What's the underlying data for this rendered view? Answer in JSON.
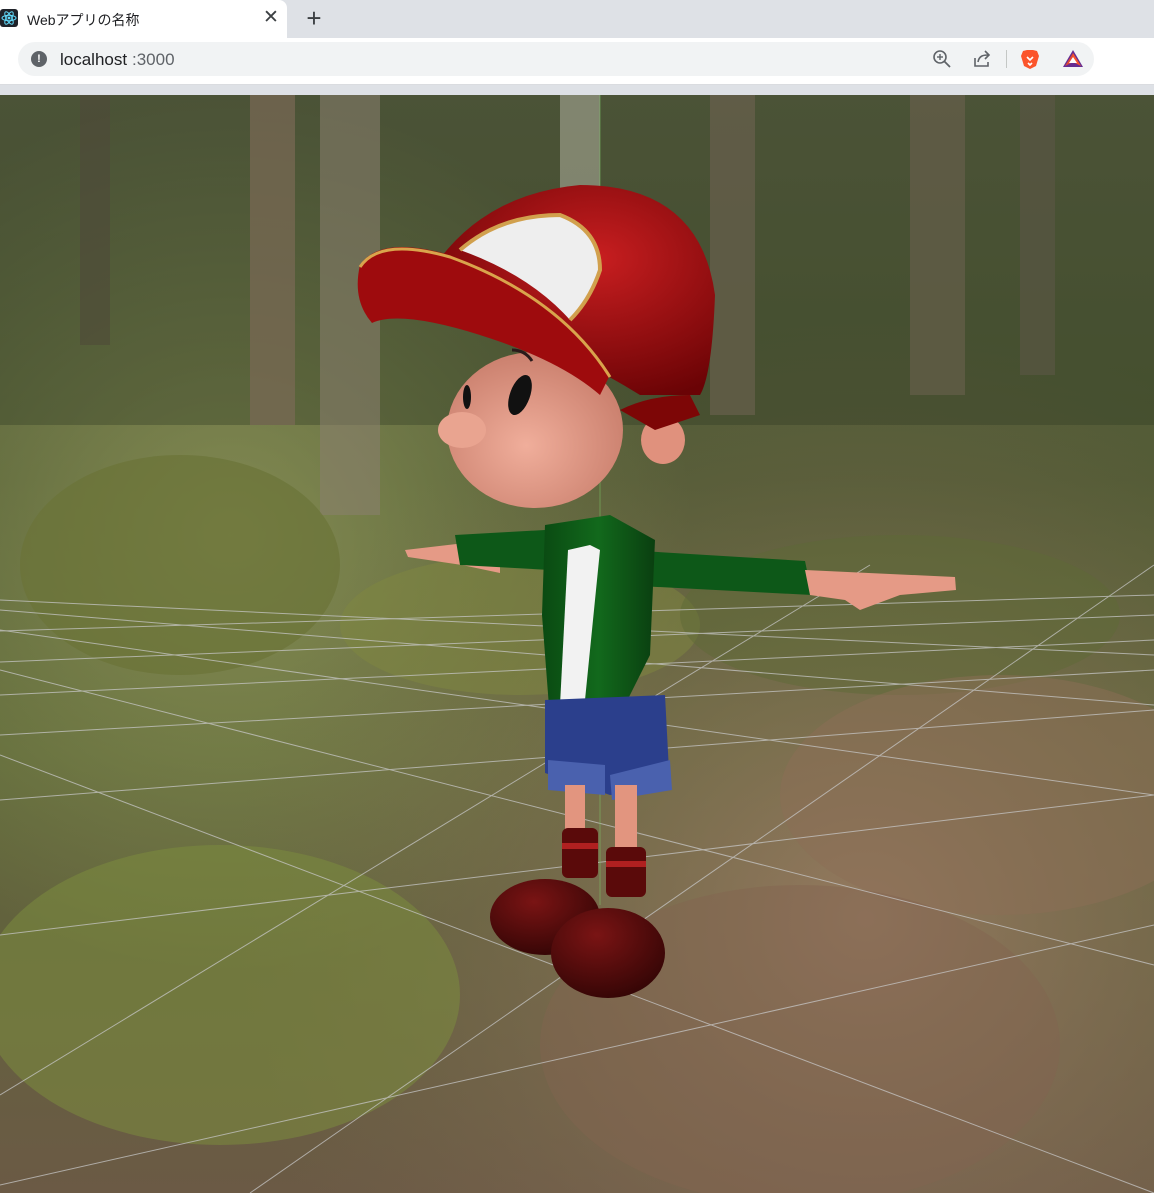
{
  "browser": {
    "tab": {
      "title": "Webアプリの名称",
      "favicon": "react-icon",
      "close_label": "✕"
    },
    "new_tab_label": "+",
    "address_bar": {
      "host": "localhost",
      "port": ":3000",
      "security_icon": "info-icon"
    },
    "toolbar_icons": [
      "zoom-icon",
      "share-icon",
      "brave-lion-icon",
      "brave-rewards-icon"
    ]
  },
  "scene": {
    "background": "forest-panorama",
    "subject": "cartoon-boy-character",
    "colors": {
      "cap": "#8e0508",
      "jacket": "#0e5a16",
      "shorts": "#2b3f8c",
      "skin": "#e7a08d",
      "shoes": "#4a0808"
    }
  }
}
